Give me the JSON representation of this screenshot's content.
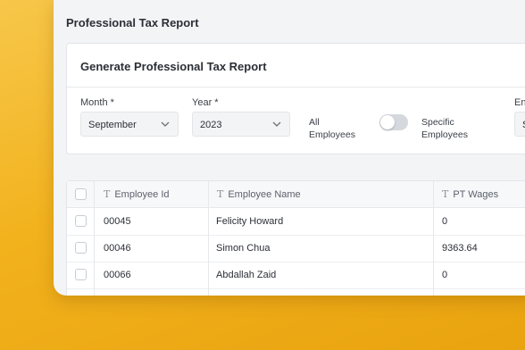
{
  "page": {
    "title": "Professional Tax Report"
  },
  "form": {
    "title": "Generate Professional Tax Report",
    "month": {
      "label": "Month *",
      "value": "September"
    },
    "year": {
      "label": "Year *",
      "value": "2023"
    },
    "all_employees_label": "All Employees",
    "specific_employees_label": "Specific Employees",
    "toggle_state": "off",
    "cut_label": "En",
    "cut_value": "S"
  },
  "table": {
    "columns": [
      "Employee Id",
      "Employee Name",
      "PT Wages"
    ],
    "rows": [
      {
        "id": "00045",
        "name": "Felicity Howard",
        "pt_wages": "0"
      },
      {
        "id": "00046",
        "name": "Simon Chua",
        "pt_wages": "9363.64"
      },
      {
        "id": "00066",
        "name": "Abdallah Zaid",
        "pt_wages": "0"
      }
    ]
  },
  "colors": {
    "accent_background": "#f2b21d"
  }
}
